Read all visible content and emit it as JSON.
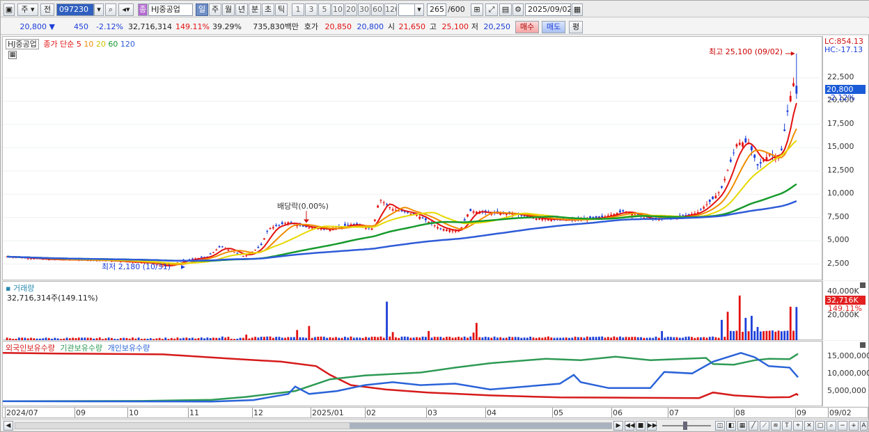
{
  "toolbar": {
    "market": "주",
    "prev": "전",
    "code": "097230",
    "class_badge": "종",
    "name": "HJ중공업",
    "periods": [
      "일",
      "주",
      "월",
      "년",
      "분",
      "초",
      "틱"
    ],
    "active_period": "일",
    "minutes": [
      "1",
      "3",
      "5",
      "10",
      "20",
      "30",
      "60",
      "120"
    ],
    "count": "265",
    "count_max": "/600",
    "date": "2025/09/02"
  },
  "quote": {
    "price": "20,800",
    "arrow": "▼",
    "change": "450",
    "change_pct": "-2.12%",
    "volume": "32,716,314",
    "volume_ratio": "149.11%",
    "turnover": "39.29%",
    "amount": "735,830백만",
    "bid_label": "호가",
    "ask": "20,850",
    "bid": "20,800",
    "open_label": "시",
    "open": "21,650",
    "high_label": "고",
    "high": "25,100",
    "low_label": "저",
    "low": "20,250",
    "buy": "매수",
    "sell": "매도",
    "eval": "평"
  },
  "price_panel": {
    "title": "HJ중공업",
    "ma_label": "종가 단순",
    "ma": [
      "5",
      "10",
      "20",
      "60",
      "120"
    ],
    "ma_colors": [
      "#e31010",
      "#f08c00",
      "#e6d800",
      "#169a2c",
      "#2e5bd8"
    ],
    "high_note": "최고 25,100 (09/02)",
    "low_note": "최저 2,180 (10/31)",
    "dividend": "배당락(0.00%)",
    "lc": "LC:854.13",
    "hc": "HC:-17.13",
    "last_badge": "20,800",
    "last_pct": "-2.12%",
    "ticks": [
      "22,500",
      "20,000",
      "17,500",
      "15,000",
      "12,500",
      "10,000",
      "7,500",
      "5,000",
      "2,500"
    ],
    "ymin": 1500,
    "ymax": 26000
  },
  "volume_panel": {
    "title": "거래량",
    "value": "32,716,314주(149.11%)",
    "badge": "32,716K",
    "badge_pct": "149.11%",
    "ticks": [
      "40,000K",
      "20,000K"
    ]
  },
  "holding_panel": {
    "legend": [
      "외국인보유수량",
      "기관보유수량",
      "개인보유수량"
    ],
    "colors": [
      "#d61a1a",
      "#2e9a55",
      "#2a63d8"
    ],
    "ticks": [
      "15,000,000",
      "10,000,000",
      "5,000,000"
    ]
  },
  "xaxis": {
    "labels": [
      "2024/07",
      "09",
      "10",
      "11",
      "12",
      "2025/01",
      "02",
      "03",
      "04",
      "05",
      "06",
      "07",
      "08",
      "09",
      "09/02"
    ]
  },
  "colors": {
    "up": "#e31010",
    "down": "#1c3fd8",
    "badge_price": "#1a5bd8",
    "badge_volume": "#e22020"
  }
}
